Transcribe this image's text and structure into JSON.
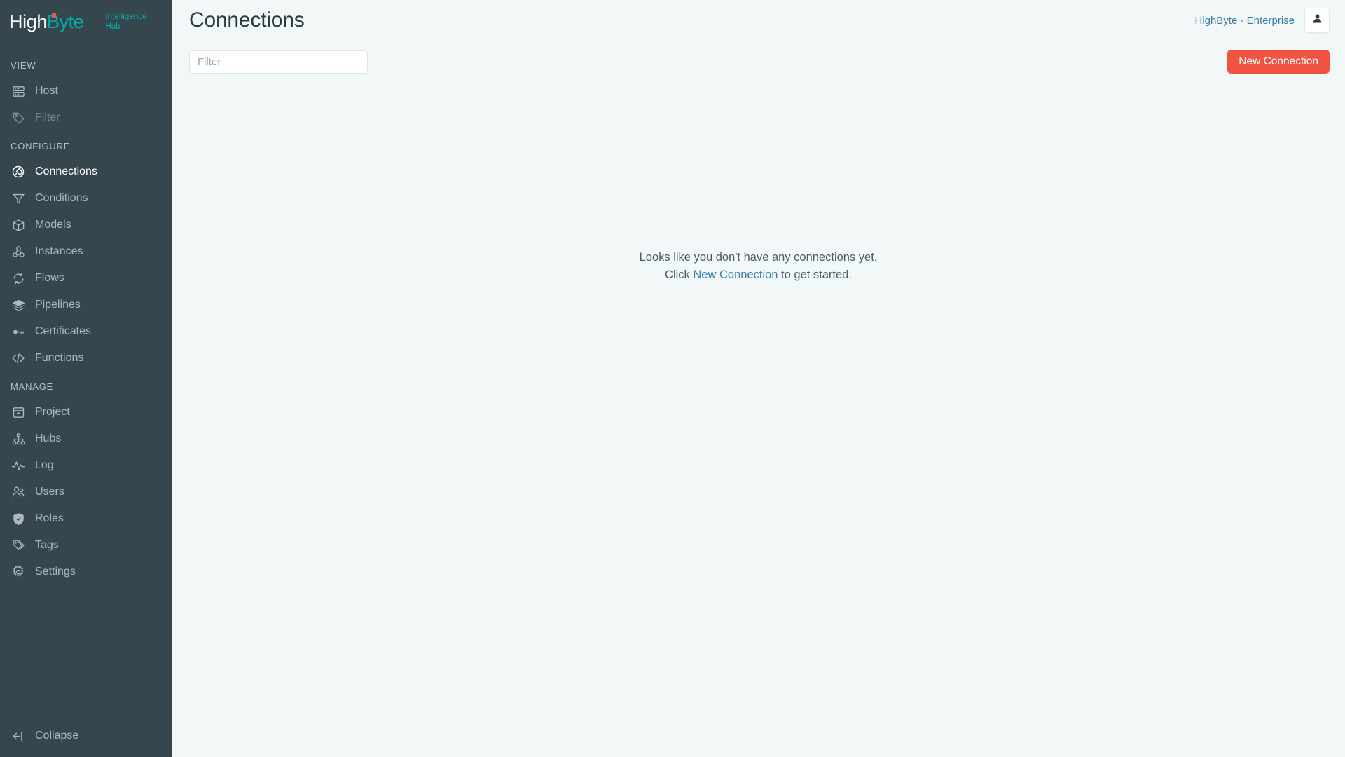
{
  "brand": {
    "name_part1": "High",
    "name_part2": "Byte",
    "product_line1": "Intelligence",
    "product_line2": "Hub",
    "accent_teal": "#00b0ab",
    "accent_dot": "#f05340"
  },
  "sidebar": {
    "sections": [
      {
        "title": "VIEW",
        "items": [
          {
            "label": "Host",
            "icon": "server-icon",
            "state": "normal"
          },
          {
            "label": "Filter",
            "icon": "tag-icon",
            "state": "disabled"
          }
        ]
      },
      {
        "title": "CONFIGURE",
        "items": [
          {
            "label": "Connections",
            "icon": "plug-circle-icon",
            "state": "active"
          },
          {
            "label": "Conditions",
            "icon": "funnel-icon",
            "state": "normal"
          },
          {
            "label": "Models",
            "icon": "cube-icon",
            "state": "normal"
          },
          {
            "label": "Instances",
            "icon": "cubes-icon",
            "state": "normal"
          },
          {
            "label": "Flows",
            "icon": "refresh-icon",
            "state": "normal"
          },
          {
            "label": "Pipelines",
            "icon": "layers-icon",
            "state": "normal"
          },
          {
            "label": "Certificates",
            "icon": "key-icon",
            "state": "normal"
          },
          {
            "label": "Functions",
            "icon": "code-icon",
            "state": "normal"
          }
        ]
      },
      {
        "title": "MANAGE",
        "items": [
          {
            "label": "Project",
            "icon": "archive-icon",
            "state": "normal"
          },
          {
            "label": "Hubs",
            "icon": "sitemap-icon",
            "state": "normal"
          },
          {
            "label": "Log",
            "icon": "activity-icon",
            "state": "normal"
          },
          {
            "label": "Users",
            "icon": "users-icon",
            "state": "normal"
          },
          {
            "label": "Roles",
            "icon": "shield-check-icon",
            "state": "normal"
          },
          {
            "label": "Tags",
            "icon": "tags-icon",
            "state": "normal"
          },
          {
            "label": "Settings",
            "icon": "gear-icon",
            "state": "normal"
          }
        ]
      }
    ],
    "collapse": {
      "label": "Collapse",
      "icon": "collapse-left-icon"
    }
  },
  "header": {
    "title": "Connections",
    "tenant": "HighByte - Enterprise",
    "user_icon": "user-icon"
  },
  "toolbar": {
    "filter_placeholder": "Filter",
    "filter_value": "",
    "new_button_label": "New Connection",
    "new_button_color": "#f05340"
  },
  "empty_state": {
    "line1": "Looks like you don't have any connections yet.",
    "line2_prefix": "Click ",
    "line2_link": "New Connection",
    "line2_suffix": " to get started."
  }
}
